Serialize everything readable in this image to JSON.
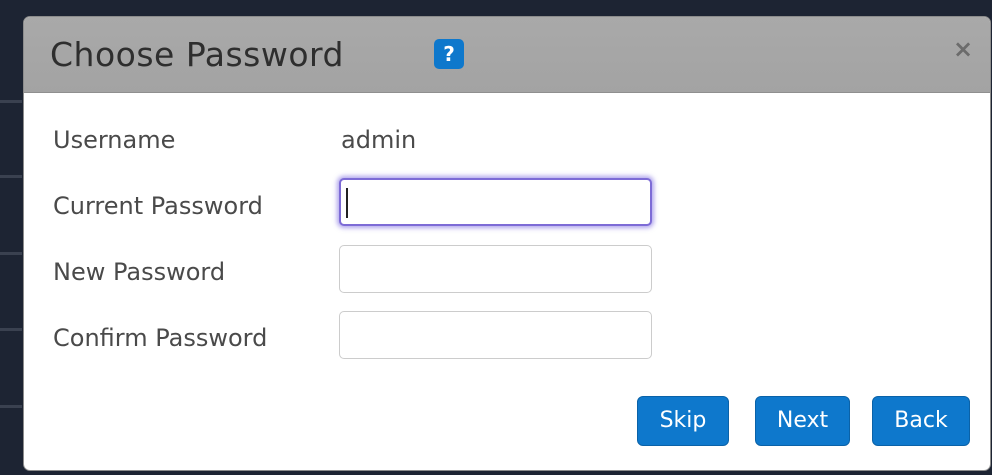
{
  "dialog": {
    "title": "Choose Password",
    "help_icon": "question-icon",
    "close_icon": "close-icon",
    "close_glyph": "×",
    "help_glyph": "?"
  },
  "form": {
    "username_label": "Username",
    "username_value": "admin",
    "current_password_label": "Current Password",
    "current_password_value": "",
    "new_password_label": "New Password",
    "new_password_value": "",
    "confirm_password_label": "Confirm Password",
    "confirm_password_value": ""
  },
  "buttons": {
    "skip_label": "Skip",
    "next_label": "Next",
    "back_label": "Back"
  },
  "colors": {
    "accent": "#0e78cc",
    "titlebar": "#a9a9a9",
    "focus_ring": "#7d6bd6"
  }
}
